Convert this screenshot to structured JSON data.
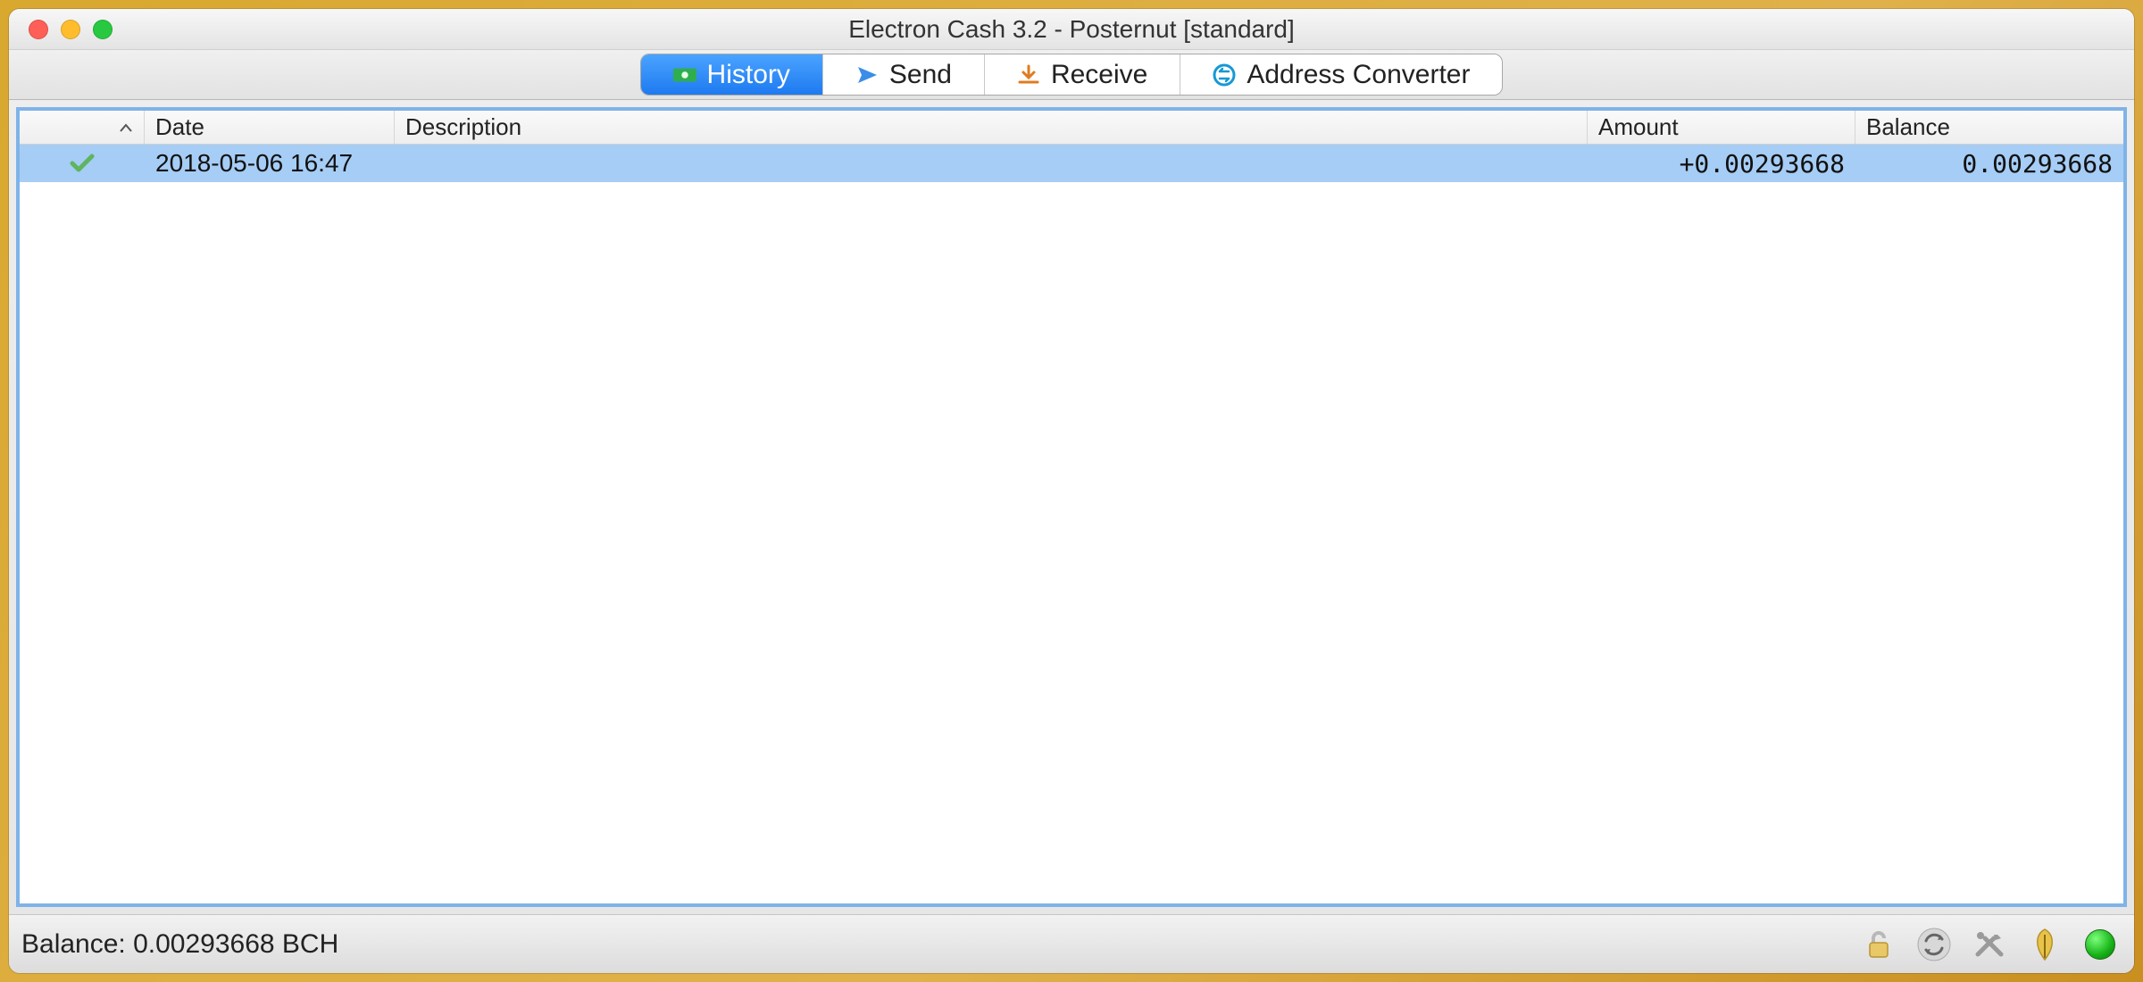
{
  "window": {
    "title": "Electron Cash 3.2  -  Posternut  [standard]"
  },
  "tabs": {
    "history": "History",
    "send": "Send",
    "receive": "Receive",
    "address_converter": "Address Converter"
  },
  "columns": {
    "date": "Date",
    "description": "Description",
    "amount": "Amount",
    "balance": "Balance"
  },
  "transactions": [
    {
      "date": "2018-05-06 16:47",
      "description": "",
      "amount": "+0.00293668",
      "balance": "0.00293668"
    }
  ],
  "statusbar": {
    "balance_text": "Balance: 0.00293668 BCH"
  }
}
